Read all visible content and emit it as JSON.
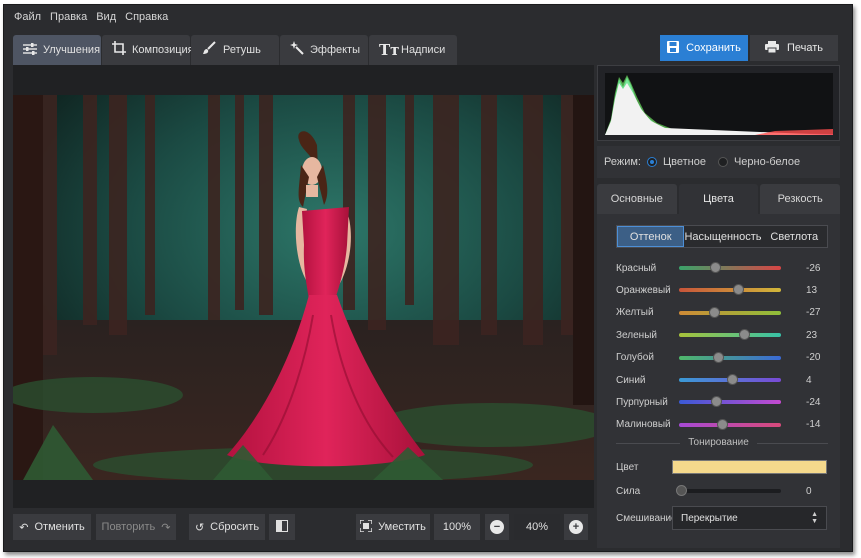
{
  "menu": [
    "Файл",
    "Правка",
    "Вид",
    "Справка"
  ],
  "tools": [
    {
      "label": "Улучшения",
      "icon": "sliders-icon",
      "active": true
    },
    {
      "label": "Композиция",
      "icon": "crop-icon",
      "active": false
    },
    {
      "label": "Ретушь",
      "icon": "brush-icon",
      "active": false
    },
    {
      "label": "Эффекты",
      "icon": "magic-wand-icon",
      "active": false
    },
    {
      "label": "Надписи",
      "icon": "text-icon",
      "active": false
    }
  ],
  "actions": {
    "save": "Сохранить",
    "print": "Печать"
  },
  "mode": {
    "label": "Режим:",
    "options": [
      "Цветное",
      "Черно-белое"
    ],
    "selected": "Цветное"
  },
  "panel_tabs": [
    {
      "label": "Основные",
      "active": false
    },
    {
      "label": "Цвета",
      "active": true
    },
    {
      "label": "Резкость",
      "active": false
    }
  ],
  "sub_tabs": [
    {
      "label": "Оттенок",
      "active": true
    },
    {
      "label": "Насыщенность",
      "active": false
    },
    {
      "label": "Светлота",
      "active": false
    }
  ],
  "hue_sliders": [
    {
      "label": "Красный",
      "value": "-26",
      "level": 0.35,
      "gradient": [
        "#3aa36a",
        "#d84545"
      ]
    },
    {
      "label": "Оранжевый",
      "value": "13",
      "level": 0.58,
      "gradient": [
        "#c8553a",
        "#d1b73a"
      ]
    },
    {
      "label": "Желтый",
      "value": "-27",
      "level": 0.34,
      "gradient": [
        "#cf8a36",
        "#8fbf3a"
      ]
    },
    {
      "label": "Зеленый",
      "value": "23",
      "level": 0.64,
      "gradient": [
        "#a8c23a",
        "#37c2a8"
      ]
    },
    {
      "label": "Голубой",
      "value": "-20",
      "level": 0.38,
      "gradient": [
        "#4fb86a",
        "#3a6ad6"
      ]
    },
    {
      "label": "Синий",
      "value": "4",
      "level": 0.52,
      "gradient": [
        "#3a9ad6",
        "#7a4ad6"
      ]
    },
    {
      "label": "Пурпурный",
      "value": "-24",
      "level": 0.36,
      "gradient": [
        "#3a5ad6",
        "#c44ad0"
      ]
    },
    {
      "label": "Малиновый",
      "value": "-14",
      "level": 0.42,
      "gradient": [
        "#a64ad6",
        "#d84a7a"
      ]
    }
  ],
  "toning": {
    "title": "Тонирование",
    "color_label": "Цвет",
    "color": "#f5d98c",
    "force_label": "Сила",
    "force_value": "0",
    "blend_label": "Смешивание",
    "blend_value": "Перекрытие"
  },
  "bottom": {
    "undo": "Отменить",
    "redo": "Повторить",
    "reset": "Сбросить",
    "fit": "Уместить",
    "zoom_full": "100%",
    "zoom": "40%"
  },
  "colors": {
    "accent": "#2b7fd4",
    "panel": "#313236",
    "background": "#2b2c2f"
  }
}
